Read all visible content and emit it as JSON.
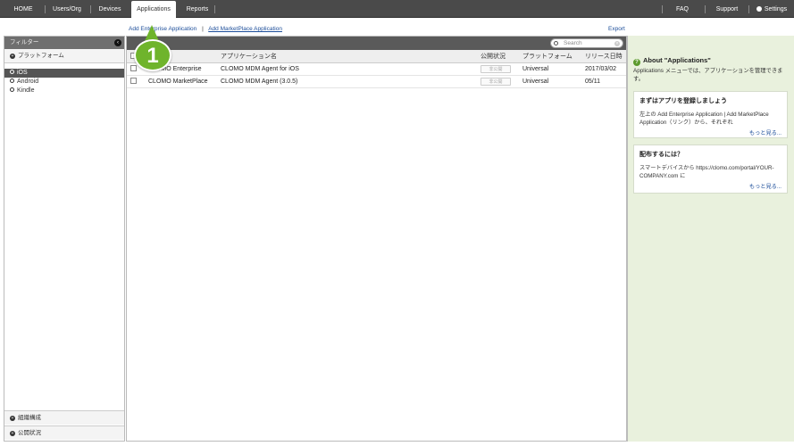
{
  "nav": {
    "left": [
      "HOME",
      "Users/Org",
      "Devices",
      "Applications",
      "Reports"
    ],
    "active": "Applications",
    "right": [
      "FAQ",
      "Support",
      "Settings"
    ]
  },
  "links": {
    "add_enterprise": "Add Enterprise Application",
    "separator": "|",
    "add_marketplace": "Add MarketPlace Application",
    "export": "Export"
  },
  "sidebar": {
    "title": "フィルター",
    "platform_section": "プラットフォーム",
    "platforms": [
      "iOS",
      "Android",
      "Kindle"
    ],
    "selected_platform": "iOS",
    "bottom_sections": [
      "組織構成",
      "公開状況"
    ]
  },
  "search": {
    "placeholder": "Search"
  },
  "table": {
    "columns": [
      "",
      "",
      "アプリケーション名",
      "公開状況",
      "プラットフォーム",
      "リリース日時"
    ],
    "rows": [
      {
        "type": "CLOMO Enterprise",
        "name": "CLOMO MDM Agent for iOS",
        "status": "非公開",
        "platform": "Universal",
        "release": "2017/03/02"
      },
      {
        "type": "CLOMO MarketPlace",
        "name": "CLOMO MDM Agent (3.0.5)",
        "status": "非公開",
        "platform": "Universal",
        "release": "05/11"
      }
    ]
  },
  "about": {
    "title": "About \"Applications\"",
    "description": "Applications メニューでは、アプリケーションを管理できます。",
    "cards": [
      {
        "title": "まずはアプリを登録しましょう",
        "body": "左上の Add Enterprise Application | Add MarketPlace Application（リンク）から、それぞれ",
        "more": "もっと見る..."
      },
      {
        "title": "配布するには？",
        "body": "スマートデバイスから https://clomo.com/portal/YOUR-COMPANY.com に",
        "more": "もっと見る..."
      }
    ]
  },
  "callout": {
    "number": "1",
    "color": "#6fb42c"
  }
}
